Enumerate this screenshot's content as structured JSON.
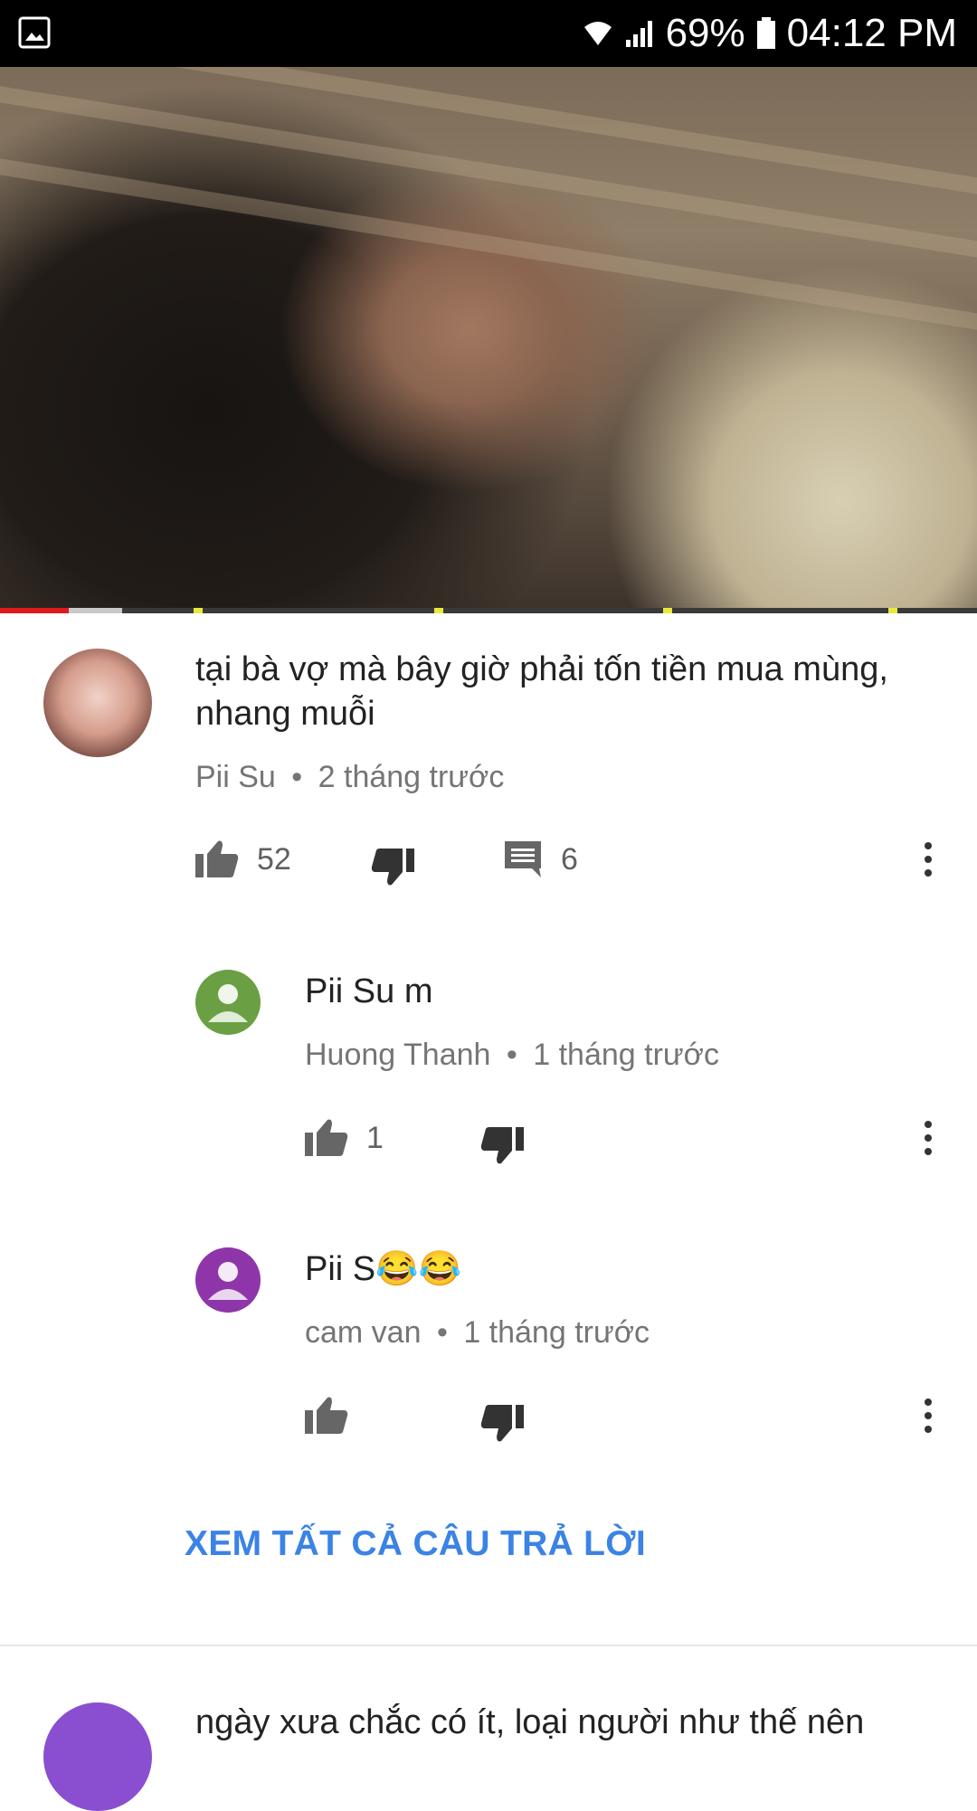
{
  "status_bar": {
    "wifi_icon": "wifi-icon",
    "signal_icon": "signal-icon",
    "battery": "69%",
    "time": "04:12 PM"
  },
  "video": {
    "progress_fraction": 0.07,
    "buffered_fraction": 0.125
  },
  "comments": [
    {
      "text": "tại bà vợ mà bây giờ phải tốn tiền mua mùng, nhang muỗi",
      "author": "Pii Su",
      "time": "2 tháng trước",
      "separator": "•",
      "likes": "52",
      "replies_count": "6"
    }
  ],
  "replies": [
    {
      "text": "Pii Su m",
      "author": "Huong Thanh",
      "separator": "•",
      "time": "1 tháng trước",
      "likes": "1",
      "avatar_color": "#6aa043"
    },
    {
      "text": "Pii S😂😂",
      "author": "cam van",
      "separator": "•",
      "time": "1 tháng trước",
      "likes": "",
      "avatar_color": "#8e35a9"
    }
  ],
  "see_all_replies": "XEM TẤT CẢ CÂU TRẢ LỜI",
  "next_comment": {
    "text": "ngày xưa chắc có ít, loại người như thế nên",
    "avatar_color": "#8a4fd0"
  }
}
